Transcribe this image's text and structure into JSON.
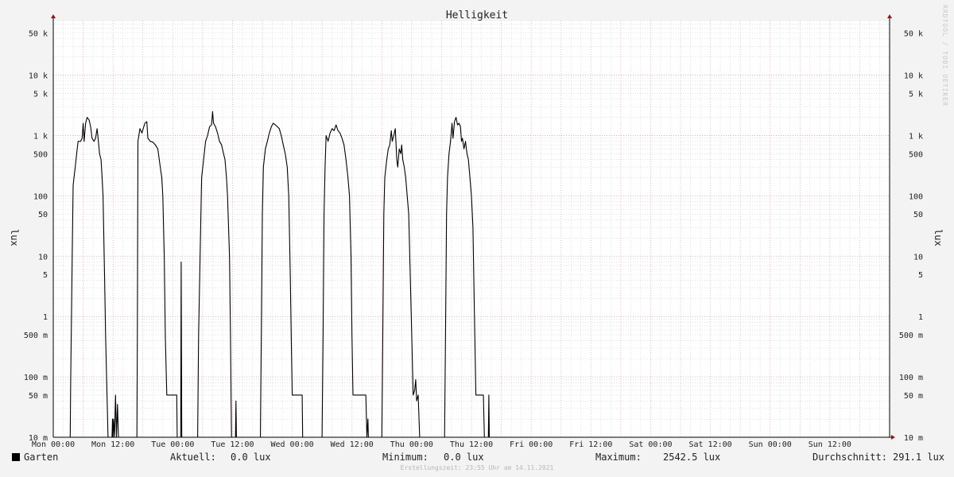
{
  "watermark": "RRDTOOL / TOBI OETIKER",
  "footer": "Erstellungszeit: 23:55 Uhr am 14.11.2021",
  "legend": {
    "series_name": "Garten",
    "current_label": "Aktuell:",
    "current_value": "0.0 lux",
    "min_label": "Minimum:",
    "min_value": "0.0 lux",
    "max_label": "Maximum:",
    "max_value": "2542.5 lux",
    "avg_label": "Durchschnitt:",
    "avg_value": "291.1 lux"
  },
  "colors": {
    "background": "#f3f3f3",
    "canvas": "#ffffff",
    "major_grid": "#e8a0b0",
    "minor_grid": "#d0d0d0",
    "line": "#000000",
    "arrow": "#a01010"
  },
  "chart_data": {
    "type": "line",
    "title": "Helligkeit",
    "ylabel": "lux",
    "y_scale": "log",
    "ylim": [
      0.01,
      80000
    ],
    "xlim": [
      0,
      168
    ],
    "x_unit": "hours since Mon 00:00",
    "grid": true,
    "y_ticks": [
      {
        "value": 0.01,
        "label": "10 m"
      },
      {
        "value": 0.05,
        "label": "50 m"
      },
      {
        "value": 0.1,
        "label": "100 m"
      },
      {
        "value": 0.5,
        "label": "500 m"
      },
      {
        "value": 1,
        "label": "1"
      },
      {
        "value": 5,
        "label": "5"
      },
      {
        "value": 10,
        "label": "10"
      },
      {
        "value": 50,
        "label": "50"
      },
      {
        "value": 100,
        "label": "100"
      },
      {
        "value": 500,
        "label": "500"
      },
      {
        "value": 1000,
        "label": "1 k"
      },
      {
        "value": 5000,
        "label": "5 k"
      },
      {
        "value": 10000,
        "label": "10 k"
      },
      {
        "value": 50000,
        "label": "50 k"
      }
    ],
    "x_ticks": [
      {
        "value": 0,
        "label": "Mon 00:00"
      },
      {
        "value": 12,
        "label": "Mon 12:00"
      },
      {
        "value": 24,
        "label": "Tue 00:00"
      },
      {
        "value": 36,
        "label": "Tue 12:00"
      },
      {
        "value": 48,
        "label": "Wed 00:00"
      },
      {
        "value": 60,
        "label": "Wed 12:00"
      },
      {
        "value": 72,
        "label": "Thu 00:00"
      },
      {
        "value": 84,
        "label": "Thu 12:00"
      },
      {
        "value": 96,
        "label": "Fri 00:00"
      },
      {
        "value": 108,
        "label": "Fri 12:00"
      },
      {
        "value": 120,
        "label": "Sat 00:00"
      },
      {
        "value": 132,
        "label": "Sat 12:00"
      },
      {
        "value": 144,
        "label": "Sun 00:00"
      },
      {
        "value": 156,
        "label": "Sun 12:00"
      }
    ],
    "series": [
      {
        "name": "Garten",
        "points": [
          [
            0,
            0.01
          ],
          [
            3.4,
            0.01
          ],
          [
            3.5,
            0.08
          ],
          [
            3.8,
            10
          ],
          [
            4.0,
            150
          ],
          [
            4.4,
            300
          ],
          [
            4.8,
            600
          ],
          [
            5.0,
            800
          ],
          [
            5.5,
            800
          ],
          [
            5.8,
            900
          ],
          [
            6.0,
            1600
          ],
          [
            6.2,
            800
          ],
          [
            6.5,
            1600
          ],
          [
            6.8,
            2000
          ],
          [
            7.2,
            1800
          ],
          [
            7.5,
            1400
          ],
          [
            7.8,
            900
          ],
          [
            8.2,
            800
          ],
          [
            8.5,
            900
          ],
          [
            8.8,
            1300
          ],
          [
            9.0,
            900
          ],
          [
            9.3,
            500
          ],
          [
            9.6,
            400
          ],
          [
            9.8,
            200
          ],
          [
            10.0,
            100
          ],
          [
            10.3,
            5
          ],
          [
            10.5,
            0.5
          ],
          [
            10.8,
            0.05
          ],
          [
            11.0,
            0.01
          ],
          [
            11.8,
            0.01
          ],
          [
            11.9,
            0.02
          ],
          [
            12.0,
            0.01
          ],
          [
            12.1,
            0.02
          ],
          [
            12.3,
            0.01
          ],
          [
            12.5,
            0.05
          ],
          [
            12.7,
            0.01
          ],
          [
            12.9,
            0.035
          ],
          [
            13.1,
            0.01
          ],
          [
            16.8,
            0.01
          ],
          [
            16.9,
            0.6
          ],
          [
            17.0,
            800
          ],
          [
            17.4,
            1300
          ],
          [
            17.8,
            1100
          ],
          [
            18.4,
            1600
          ],
          [
            18.8,
            1700
          ],
          [
            19.0,
            900
          ],
          [
            19.5,
            800
          ],
          [
            20.0,
            780
          ],
          [
            20.5,
            700
          ],
          [
            21.0,
            600
          ],
          [
            21.5,
            300
          ],
          [
            21.8,
            200
          ],
          [
            22.0,
            100
          ],
          [
            22.3,
            10
          ],
          [
            22.5,
            0.5
          ],
          [
            22.8,
            0.05
          ],
          [
            24.8,
            0.05
          ],
          [
            24.9,
            0.01
          ],
          [
            25.6,
            0.01
          ],
          [
            25.7,
            8
          ],
          [
            25.8,
            0.01
          ],
          [
            29.0,
            0.01
          ],
          [
            29.2,
            0.5
          ],
          [
            29.5,
            10
          ],
          [
            29.8,
            200
          ],
          [
            30.2,
            400
          ],
          [
            30.6,
            800
          ],
          [
            31.0,
            1000
          ],
          [
            31.4,
            1400
          ],
          [
            31.8,
            1500
          ],
          [
            32.0,
            2500
          ],
          [
            32.2,
            1600
          ],
          [
            32.6,
            1400
          ],
          [
            33.0,
            1100
          ],
          [
            33.4,
            800
          ],
          [
            33.8,
            700
          ],
          [
            34.2,
            500
          ],
          [
            34.5,
            400
          ],
          [
            34.8,
            200
          ],
          [
            35.0,
            100
          ],
          [
            35.4,
            10
          ],
          [
            35.6,
            0.5
          ],
          [
            35.8,
            0.01
          ],
          [
            36.6,
            0.01
          ],
          [
            36.7,
            0.04
          ],
          [
            36.8,
            0.01
          ],
          [
            41.6,
            0.01
          ],
          [
            41.8,
            0.5
          ],
          [
            42.0,
            50
          ],
          [
            42.2,
            300
          ],
          [
            42.6,
            600
          ],
          [
            43.0,
            800
          ],
          [
            43.4,
            1100
          ],
          [
            43.8,
            1400
          ],
          [
            44.2,
            1600
          ],
          [
            44.6,
            1500
          ],
          [
            45.0,
            1400
          ],
          [
            45.4,
            1300
          ],
          [
            45.8,
            1000
          ],
          [
            46.2,
            700
          ],
          [
            46.6,
            500
          ],
          [
            47.0,
            300
          ],
          [
            47.3,
            100
          ],
          [
            47.6,
            5
          ],
          [
            47.8,
            0.5
          ],
          [
            48.0,
            0.05
          ],
          [
            50.0,
            0.05
          ],
          [
            50.1,
            0.01
          ],
          [
            54.0,
            0.01
          ],
          [
            54.2,
            0.5
          ],
          [
            54.4,
            50
          ],
          [
            54.6,
            300
          ],
          [
            54.8,
            1000
          ],
          [
            55.2,
            800
          ],
          [
            55.6,
            1100
          ],
          [
            56.0,
            1300
          ],
          [
            56.4,
            1200
          ],
          [
            56.8,
            1500
          ],
          [
            57.2,
            1200
          ],
          [
            57.6,
            1100
          ],
          [
            58.0,
            900
          ],
          [
            58.4,
            700
          ],
          [
            58.8,
            400
          ],
          [
            59.2,
            200
          ],
          [
            59.5,
            100
          ],
          [
            59.8,
            10
          ],
          [
            60.0,
            0.5
          ],
          [
            60.2,
            0.05
          ],
          [
            62.8,
            0.05
          ],
          [
            63.0,
            0.01
          ],
          [
            63.2,
            0.02
          ],
          [
            63.3,
            0.01
          ],
          [
            66.0,
            0.01
          ],
          [
            66.2,
            0.5
          ],
          [
            66.4,
            50
          ],
          [
            66.6,
            200
          ],
          [
            67.0,
            400
          ],
          [
            67.3,
            600
          ],
          [
            67.6,
            700
          ],
          [
            67.9,
            1200
          ],
          [
            68.1,
            800
          ],
          [
            68.4,
            1000
          ],
          [
            68.7,
            1300
          ],
          [
            69.0,
            400
          ],
          [
            69.2,
            300
          ],
          [
            69.5,
            600
          ],
          [
            69.8,
            500
          ],
          [
            70.0,
            700
          ],
          [
            70.2,
            400
          ],
          [
            70.5,
            300
          ],
          [
            70.8,
            200
          ],
          [
            71.1,
            100
          ],
          [
            71.4,
            50
          ],
          [
            71.7,
            5
          ],
          [
            72.0,
            0.5
          ],
          [
            72.3,
            0.05
          ],
          [
            72.6,
            0.06
          ],
          [
            72.8,
            0.09
          ],
          [
            73.0,
            0.04
          ],
          [
            73.3,
            0.05
          ],
          [
            73.6,
            0.01
          ],
          [
            78.6,
            0.01
          ],
          [
            78.8,
            0.5
          ],
          [
            79.0,
            50
          ],
          [
            79.2,
            200
          ],
          [
            79.5,
            500
          ],
          [
            79.8,
            800
          ],
          [
            80.1,
            1600
          ],
          [
            80.3,
            900
          ],
          [
            80.6,
            1700
          ],
          [
            80.9,
            2000
          ],
          [
            81.2,
            1500
          ],
          [
            81.5,
            1600
          ],
          [
            81.8,
            1400
          ],
          [
            82.0,
            800
          ],
          [
            82.2,
            900
          ],
          [
            82.5,
            600
          ],
          [
            82.8,
            800
          ],
          [
            83.1,
            500
          ],
          [
            83.4,
            400
          ],
          [
            83.7,
            200
          ],
          [
            84.0,
            100
          ],
          [
            84.3,
            30
          ],
          [
            84.6,
            1
          ],
          [
            84.9,
            0.05
          ],
          [
            86.4,
            0.05
          ],
          [
            86.6,
            0.01
          ],
          [
            87.4,
            0.01
          ],
          [
            87.5,
            0.05
          ],
          [
            87.6,
            0.01
          ],
          [
            168,
            0.01
          ]
        ]
      }
    ]
  }
}
